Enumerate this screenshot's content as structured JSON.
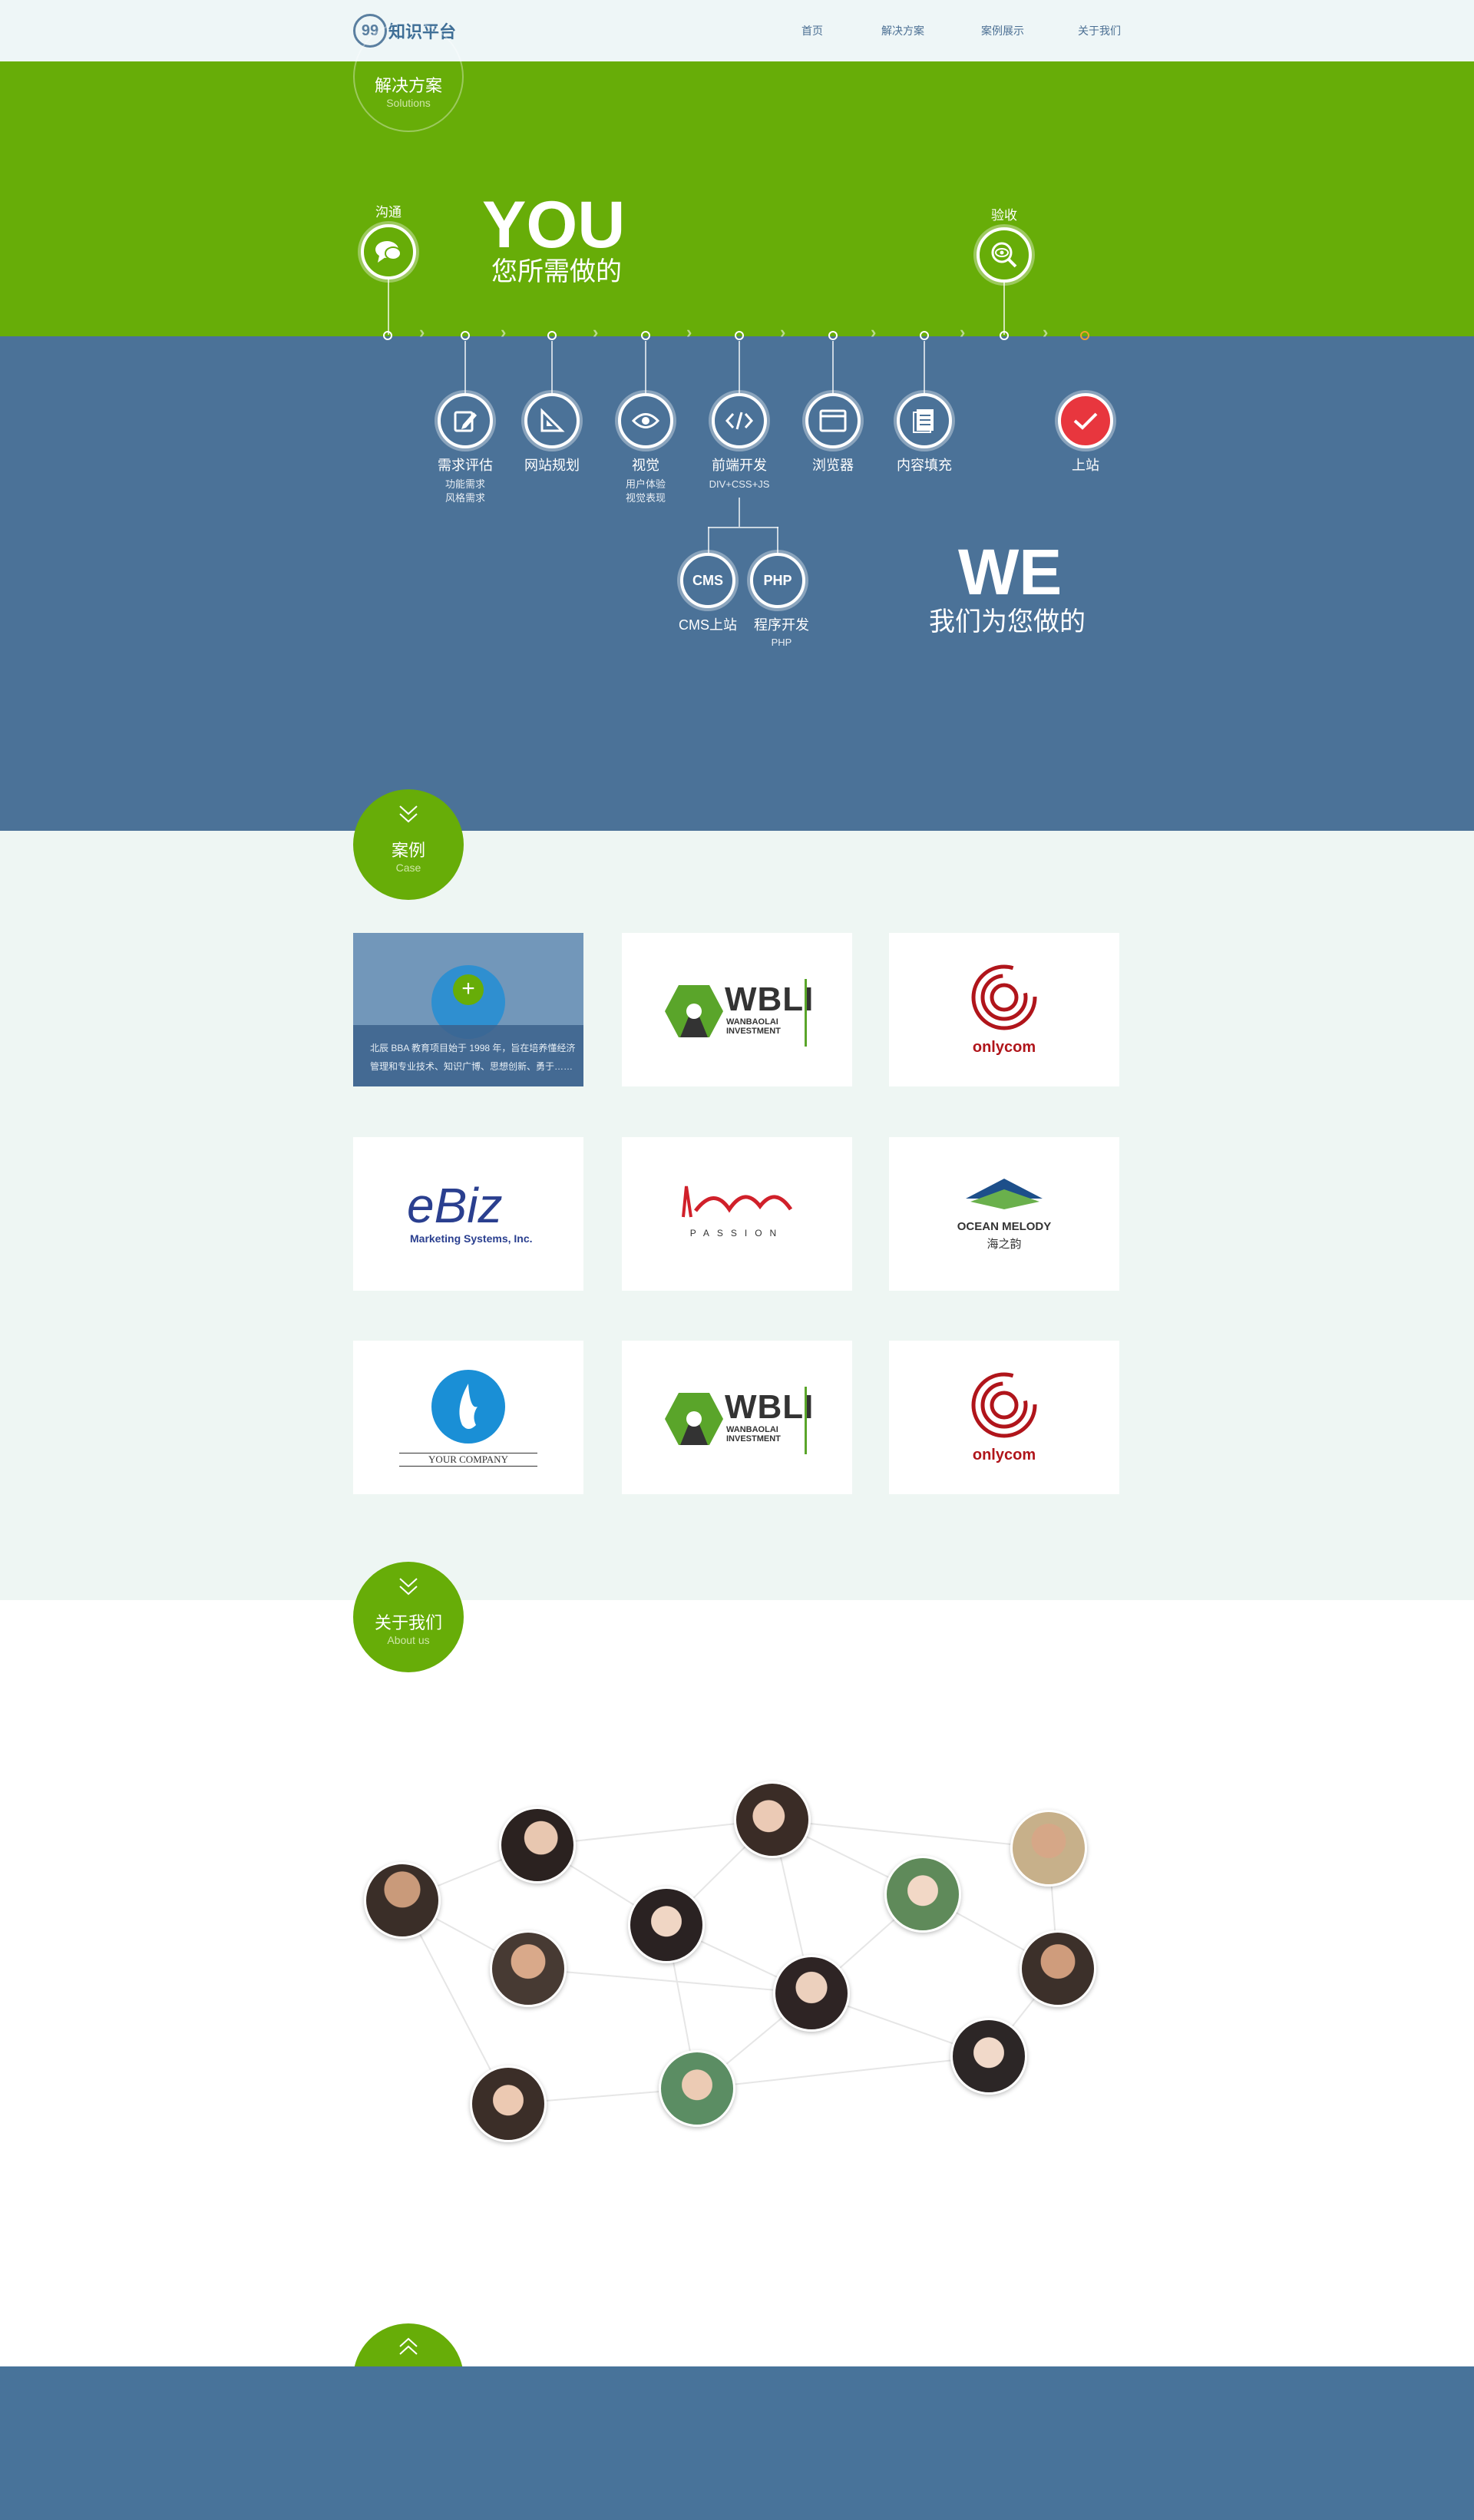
{
  "header": {
    "logo_text": "知识平台",
    "logo_number": "99",
    "nav": [
      "首页",
      "解决方案",
      "案例展示",
      "关于我们"
    ]
  },
  "solutions": {
    "badge_title": "解决方案",
    "badge_sub": "Solutions",
    "you_big": "YOU",
    "you_sub": "您所需做的",
    "we_big": "WE",
    "we_sub": "我们为您做的",
    "goutong": "沟通",
    "yanshou": "验收",
    "steps": [
      {
        "label": "需求评估",
        "sub1": "功能需求",
        "sub2": "风格需求"
      },
      {
        "label": "网站规划",
        "sub1": "",
        "sub2": ""
      },
      {
        "label": "视觉",
        "sub1": "用户体验",
        "sub2": "视觉表现"
      },
      {
        "label": "前端开发",
        "sub1": "DIV+CSS+JS",
        "sub2": ""
      },
      {
        "label": "浏览器",
        "sub1": "",
        "sub2": ""
      },
      {
        "label": "内容填充",
        "sub1": "",
        "sub2": ""
      },
      {
        "label": "上站",
        "sub1": "",
        "sub2": ""
      }
    ],
    "cms_icon": "CMS",
    "cms_label": "CMS上站",
    "php_icon": "PHP",
    "php_label": "程序开发",
    "php_sub": "PHP"
  },
  "cases": {
    "badge_title": "案例",
    "badge_sub": "Case",
    "overlay_text_1": "北辰 BBA 教育项目始于 1998 年，旨在培养懂经济",
    "overlay_text_2": "管理和专业技术、知识广博、思想创新、勇于……",
    "logos": {
      "wbli": "WBLI",
      "wbli_sub1": "WANBAOLAI",
      "wbli_sub2": "INVESTMENT",
      "onlycom": "onlycom",
      "ebiz": "eBiz",
      "ebiz_sub": "Marketing Systems, Inc.",
      "passion": "PASSION",
      "ocean": "OCEAN MELODY",
      "ocean_cn": "海之韵",
      "yourcompany": "YOUR COMPANY"
    }
  },
  "about": {
    "badge_title": "关于我们",
    "badge_sub": "About us"
  },
  "colors": {
    "green": "#67ad08",
    "blue": "#4b7298",
    "red": "#e8363e",
    "case_bg": "#eef6f3"
  }
}
